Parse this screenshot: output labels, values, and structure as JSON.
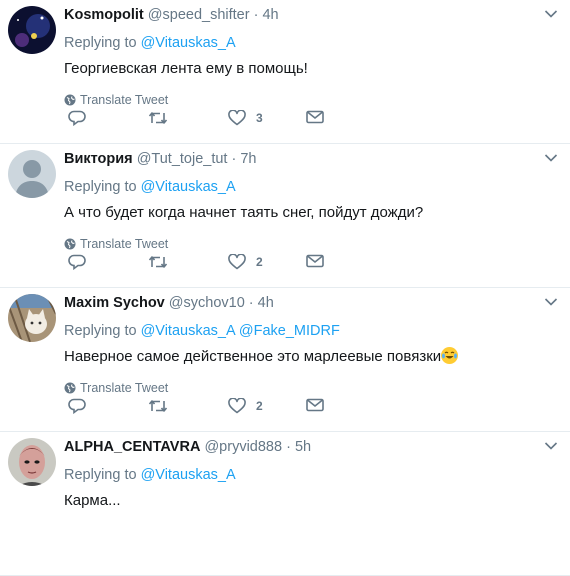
{
  "translate_label": "Translate Tweet",
  "replying_prefix": "Replying to",
  "separator": "·",
  "tweets": [
    {
      "name": "Kosmopolit",
      "handle": "@speed_shifter",
      "time": "4h",
      "reply_to": [
        "@Vitauskas_A"
      ],
      "text": "Георгиевская лента ему в помощь!",
      "likes": "3"
    },
    {
      "name": "Виктория",
      "handle": "@Tut_toje_tut",
      "time": "7h",
      "reply_to": [
        "@Vitauskas_A"
      ],
      "text": "А что будет когда начнет таять снег, пойдут дожди?",
      "likes": "2"
    },
    {
      "name": "Maxim Sychov",
      "handle": "@sychov10",
      "time": "4h",
      "reply_to": [
        "@Vitauskas_A",
        "@Fake_MIDRF"
      ],
      "text": "Наверное самое действенное это марлеевые повязки",
      "likes": "2"
    },
    {
      "name": "ALPHA_CENTAVRA",
      "handle": "@pryvid888",
      "time": "5h",
      "reply_to": [
        "@Vitauskas_A"
      ],
      "text": "Карма...",
      "likes": ""
    }
  ]
}
